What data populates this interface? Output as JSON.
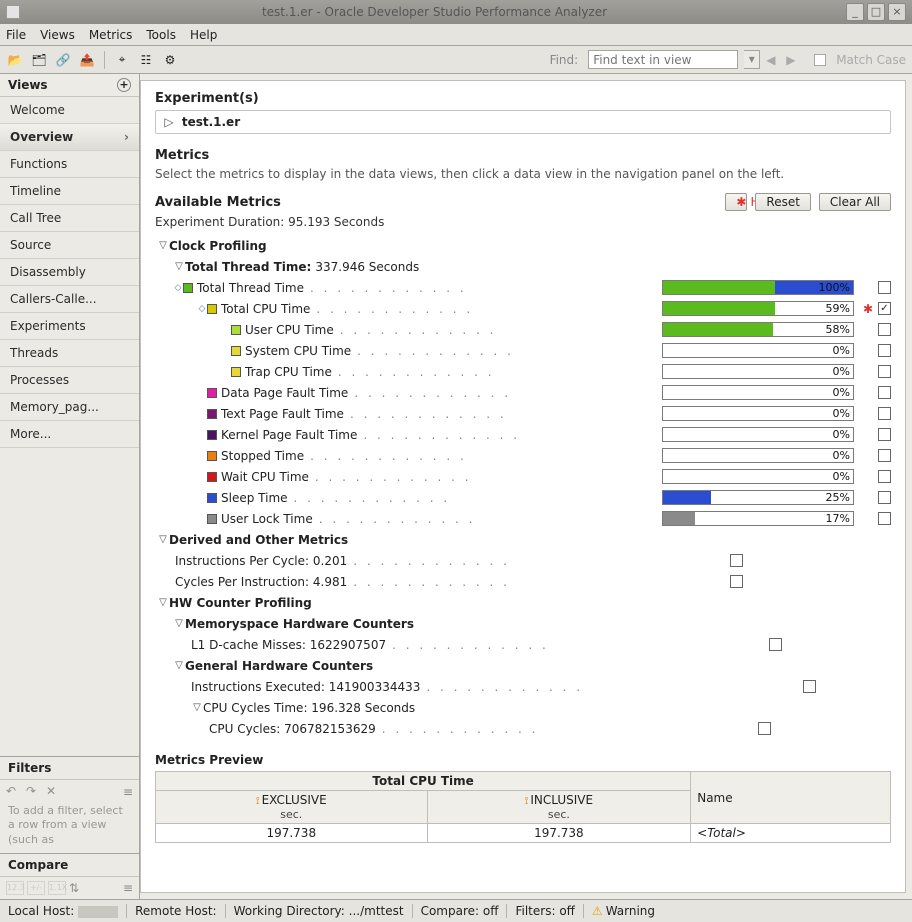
{
  "window": {
    "title": "test.1.er  -  Oracle Developer Studio Performance Analyzer"
  },
  "menu": [
    "File",
    "Views",
    "Metrics",
    "Tools",
    "Help"
  ],
  "find": {
    "label": "Find:",
    "placeholder": "Find text in view",
    "matchcase": "Match Case"
  },
  "sidebar": {
    "title": "Views",
    "items": [
      "Welcome",
      "Overview",
      "Functions",
      "Timeline",
      "Call Tree",
      "Source",
      "Disassembly",
      "Callers-Calle...",
      "Experiments",
      "Threads",
      "Processes",
      "Memory_pag...",
      "More..."
    ],
    "selected": 1,
    "filters_title": "Filters",
    "filters_hint": "To add a filter, select a row from a view (such as",
    "compare_title": "Compare"
  },
  "content": {
    "experiments_title": "Experiment(s)",
    "experiment_name": "test.1.er",
    "metrics_title": "Metrics",
    "metrics_desc": "Select the metrics to display in the data views, then click a data view in the navigation panel on the left.",
    "available_title": "Available Metrics",
    "buttons": {
      "hot": "Hot",
      "reset": "Reset",
      "clearall": "Clear All"
    },
    "duration": "Experiment Duration: 95.193 Seconds",
    "groups": {
      "clock": "Clock Profiling",
      "ttt": "Total Thread Time",
      "ttt_val": "337.946 Seconds",
      "derived": "Derived and Other Metrics",
      "hw": "HW Counter Profiling",
      "memhw": "Memoryspace Hardware Counters",
      "genhw": "General Hardware Counters",
      "cputime": "CPU Cycles Time: 196.328 Seconds"
    },
    "rows": [
      {
        "indent": 2,
        "tog": true,
        "color": "#5bbb1e",
        "label": "Total Thread Time",
        "bars": [
          [
            "#5bbb1e",
            59
          ],
          [
            "#2a4ecf",
            41
          ]
        ],
        "pct": "100%",
        "checked": false
      },
      {
        "indent": 3,
        "tog": true,
        "color": "#d7c900",
        "label": "Total CPU Time",
        "bars": [
          [
            "#5bbb1e",
            59
          ]
        ],
        "pct": "59%",
        "hot": true,
        "checked": true
      },
      {
        "indent": 4,
        "color": "#aedc3a",
        "label": "User CPU Time",
        "bars": [
          [
            "#5bbb1e",
            58
          ]
        ],
        "pct": "58%",
        "checked": false
      },
      {
        "indent": 4,
        "color": "#e5d837",
        "label": "System CPU Time",
        "bars": [],
        "pct": "0%",
        "checked": false
      },
      {
        "indent": 4,
        "color": "#e5d837",
        "label": "Trap CPU Time",
        "bars": [],
        "pct": "0%",
        "checked": false
      },
      {
        "indent": 3,
        "color": "#e21ea6",
        "label": "Data Page Fault Time",
        "bars": [],
        "pct": "0%",
        "checked": false
      },
      {
        "indent": 3,
        "color": "#7a176e",
        "label": "Text Page Fault Time",
        "bars": [],
        "pct": "0%",
        "checked": false
      },
      {
        "indent": 3,
        "color": "#4a135f",
        "label": "Kernel Page Fault Time",
        "bars": [],
        "pct": "0%",
        "checked": false
      },
      {
        "indent": 3,
        "color": "#e97f0e",
        "label": "Stopped Time",
        "bars": [],
        "pct": "0%",
        "checked": false
      },
      {
        "indent": 3,
        "color": "#d31818",
        "label": "Wait CPU Time",
        "bars": [],
        "pct": "0%",
        "checked": false
      },
      {
        "indent": 3,
        "color": "#2a4ecf",
        "label": "Sleep Time",
        "bars": [
          [
            "#2a4ecf",
            25
          ]
        ],
        "pct": "25%",
        "checked": false
      },
      {
        "indent": 3,
        "color": "#8a8a8a",
        "label": "User Lock Time",
        "bars": [
          [
            "#8a8a8a",
            17
          ]
        ],
        "pct": "17%",
        "checked": false
      }
    ],
    "derived": [
      {
        "label": "Instructions Per Cycle: 0.201"
      },
      {
        "label": "Cycles Per Instruction: 4.981"
      }
    ],
    "memhw": [
      {
        "label": "L1 D-cache Misses: 1622907507"
      }
    ],
    "genhw": [
      {
        "label": "Instructions Executed: 141900334433"
      },
      {
        "label": "CPU Cycles: 706782153629",
        "indent": true
      }
    ],
    "preview": {
      "title": "Metrics Preview",
      "grp": "Total CPU Time",
      "name_hdr": "Name",
      "exc": "EXCLUSIVE",
      "inc": "INCLUSIVE",
      "unit": "sec.",
      "exc_val": "197.738",
      "inc_val": "197.738",
      "name_val": "<Total>"
    }
  },
  "status": {
    "localhost": "Local Host:",
    "remotehost": "Remote Host:",
    "wd": "Working Directory: .../mttest",
    "compare": "Compare: off",
    "filters": "Filters: off",
    "warning": "Warning"
  }
}
